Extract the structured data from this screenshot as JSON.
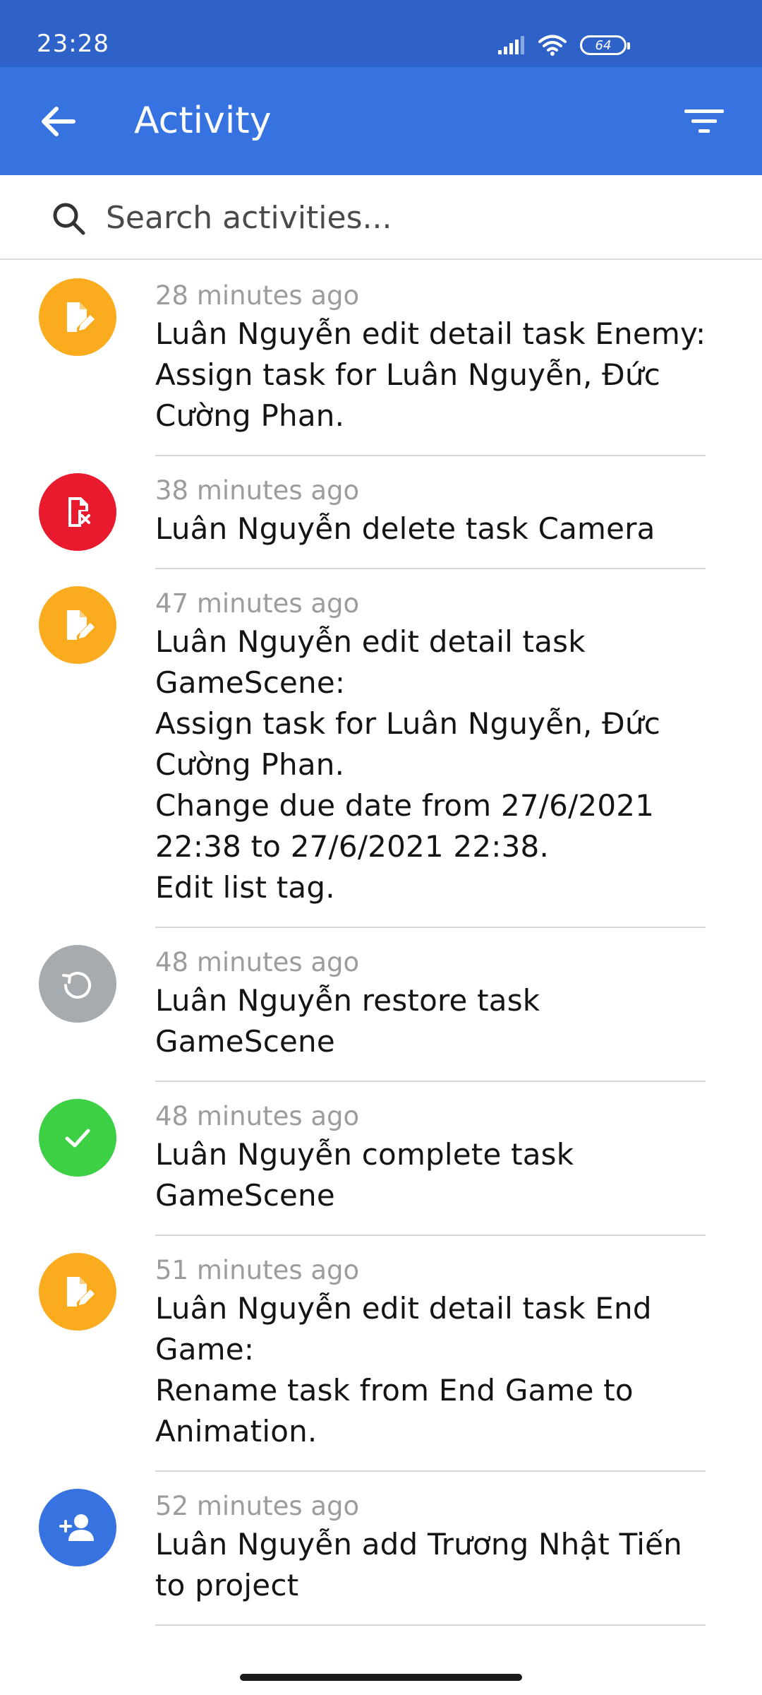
{
  "status_bar": {
    "time": "23:28",
    "battery": "64",
    "icons": [
      "signal-icon",
      "wifi-icon",
      "battery-icon"
    ]
  },
  "app_bar": {
    "title": "Activity",
    "back_icon": "arrow-back-icon",
    "filter_icon": "filter-icon",
    "color": "#3673e0"
  },
  "search": {
    "placeholder": "Search activities..."
  },
  "activities": [
    {
      "time": "28 minutes ago",
      "text": "Luân Nguyễn edit detail task Enemy:\nAssign task for Luân Nguyễn, Đức Cường Phan.",
      "icon": "edit-document-icon",
      "color": "#fbab1e"
    },
    {
      "time": "38 minutes ago",
      "text": "Luân Nguyễn delete task Camera",
      "icon": "delete-document-icon",
      "color": "#ea1a2e"
    },
    {
      "time": "47 minutes ago",
      "text": "Luân Nguyễn edit detail task GameScene:\nAssign task for Luân Nguyễn, Đức Cường Phan.\nChange due date from 27/6/2021 22:38 to 27/6/2021 22:38.\nEdit list tag.",
      "icon": "edit-document-icon",
      "color": "#fbab1e"
    },
    {
      "time": "48 minutes ago",
      "text": "Luân Nguyễn restore task GameScene",
      "icon": "restore-icon",
      "color": "#a6abaf"
    },
    {
      "time": "48 minutes ago",
      "text": "Luân Nguyễn complete task GameScene",
      "icon": "checkmark-icon",
      "color": "#3dcf44"
    },
    {
      "time": "51 minutes ago",
      "text": "Luân Nguyễn edit detail task End Game:\nRename task from End Game to Animation.",
      "icon": "edit-document-icon",
      "color": "#fbab1e"
    },
    {
      "time": "52 minutes ago",
      "text": "Luân Nguyễn add Trương Nhật Tiến to project",
      "icon": "add-person-icon",
      "color": "#3673e0"
    }
  ]
}
